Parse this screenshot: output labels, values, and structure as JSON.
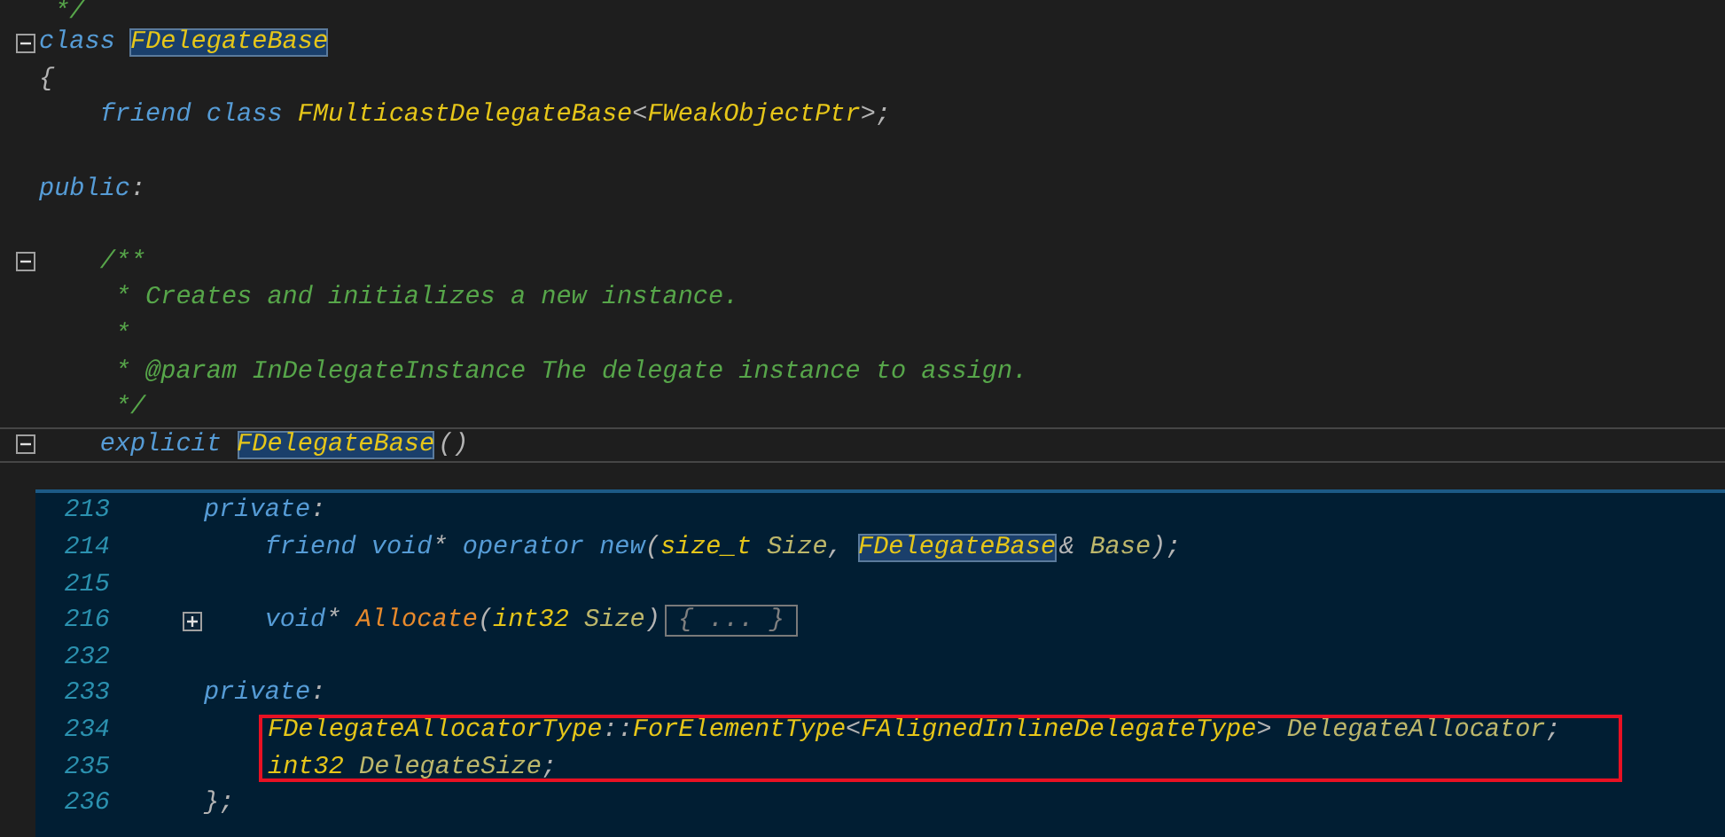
{
  "top_pane": {
    "lines": [
      {
        "kind": "plain",
        "current": false,
        "tokens": [
          {
            "kind": "comment",
            "t": " */"
          }
        ]
      },
      {
        "kind": "fold-open",
        "current": false,
        "tokens": [
          {
            "kind": "keyword",
            "t": "class "
          },
          {
            "kind": "reference",
            "t": "FDelegateBase"
          }
        ]
      },
      {
        "kind": "plain",
        "current": false,
        "tokens": [
          {
            "kind": "punct",
            "t": "{"
          }
        ]
      },
      {
        "kind": "plain",
        "current": false,
        "tokens": [
          {
            "kind": "keyword",
            "t": "    friend class "
          },
          {
            "kind": "type",
            "t": "FMulticastDelegateBase"
          },
          {
            "kind": "punct",
            "t": "<"
          },
          {
            "kind": "type",
            "t": "FWeakObjectPtr"
          },
          {
            "kind": "punct",
            "t": ">;"
          }
        ]
      },
      {
        "kind": "plain",
        "current": false
      },
      {
        "kind": "plain",
        "current": false,
        "tokens": [
          {
            "kind": "keyword",
            "t": "public"
          },
          {
            "kind": "punct",
            "t": ":"
          }
        ]
      },
      {
        "kind": "plain",
        "current": false
      },
      {
        "kind": "fold-open",
        "current": false,
        "tokens": [
          {
            "kind": "comment",
            "t": "    /**"
          }
        ]
      },
      {
        "kind": "plain",
        "current": false,
        "tokens": [
          {
            "kind": "comment",
            "t": "     * Creates and initializes a new instance."
          }
        ]
      },
      {
        "kind": "plain",
        "current": false,
        "tokens": [
          {
            "kind": "comment",
            "t": "     *"
          }
        ]
      },
      {
        "kind": "plain",
        "current": false,
        "tokens": [
          {
            "kind": "comment",
            "t": "     * @param InDelegateInstance The delegate instance to assign."
          }
        ]
      },
      {
        "kind": "plain",
        "current": false,
        "tokens": [
          {
            "kind": "comment",
            "t": "     */"
          }
        ]
      },
      {
        "kind": "fold-open",
        "current": true,
        "tokens": [
          {
            "kind": "keyword",
            "t": "    explicit "
          },
          {
            "kind": "reference",
            "t": "FDelegateBase"
          },
          {
            "kind": "punct",
            "t": "()"
          }
        ]
      }
    ]
  },
  "bottom_pane": {
    "lines": [
      {
        "number": "213",
        "kind": "plain",
        "boxed": false,
        "tokens": [
          {
            "kind": "keyword",
            "t": "private"
          },
          {
            "kind": "punct",
            "t": ":"
          }
        ]
      },
      {
        "number": "214",
        "kind": "plain",
        "boxed": false,
        "tokens": [
          {
            "kind": "keyword",
            "t": "    friend void"
          },
          {
            "kind": "punct",
            "t": "* "
          },
          {
            "kind": "keyword",
            "t": "operator new"
          },
          {
            "kind": "punct",
            "t": "("
          },
          {
            "kind": "type",
            "t": "size_t"
          },
          {
            "kind": "ident",
            "t": " Size"
          },
          {
            "kind": "punct",
            "t": ", "
          },
          {
            "kind": "reference",
            "t": "FDelegateBase"
          },
          {
            "kind": "punct",
            "t": "& "
          },
          {
            "kind": "ident",
            "t": "Base"
          },
          {
            "kind": "punct",
            "t": ");"
          }
        ]
      },
      {
        "number": "215",
        "kind": "plain",
        "boxed": false
      },
      {
        "number": "216",
        "kind": "fold-closed",
        "boxed": false,
        "tokens": [
          {
            "kind": "keyword",
            "t": "    void"
          },
          {
            "kind": "punct",
            "t": "* "
          },
          {
            "kind": "function",
            "t": "Allocate"
          },
          {
            "kind": "punct",
            "t": "("
          },
          {
            "kind": "type",
            "t": "int32"
          },
          {
            "kind": "ident",
            "t": " Size"
          },
          {
            "kind": "punct",
            "t": ")"
          }
        ],
        "collapsed": "{ ... }"
      },
      {
        "number": "232",
        "kind": "plain",
        "boxed": false
      },
      {
        "number": "233",
        "kind": "plain",
        "boxed": false,
        "tokens": [
          {
            "kind": "keyword",
            "t": "private"
          },
          {
            "kind": "punct",
            "t": ":"
          }
        ]
      },
      {
        "number": "234",
        "kind": "plain",
        "boxed": true,
        "tokens": [
          {
            "kind": "type",
            "t": "FDelegateAllocatorType"
          },
          {
            "kind": "punct",
            "t": "::"
          },
          {
            "kind": "type",
            "t": "ForElementType"
          },
          {
            "kind": "punct",
            "t": "<"
          },
          {
            "kind": "type",
            "t": "FAlignedInlineDelegateType"
          },
          {
            "kind": "punct",
            "t": "> "
          },
          {
            "kind": "ident",
            "t": "DelegateAllocator"
          },
          {
            "kind": "punct",
            "t": ";"
          }
        ]
      },
      {
        "number": "235",
        "kind": "plain",
        "boxed": true,
        "tokens": [
          {
            "kind": "type",
            "t": "int32"
          },
          {
            "kind": "ident",
            "t": " DelegateSize"
          },
          {
            "kind": "punct",
            "t": ";"
          }
        ]
      },
      {
        "number": "236",
        "kind": "plain",
        "boxed": false,
        "tokens": [
          {
            "kind": "punct",
            "t": "};"
          }
        ]
      }
    ]
  }
}
